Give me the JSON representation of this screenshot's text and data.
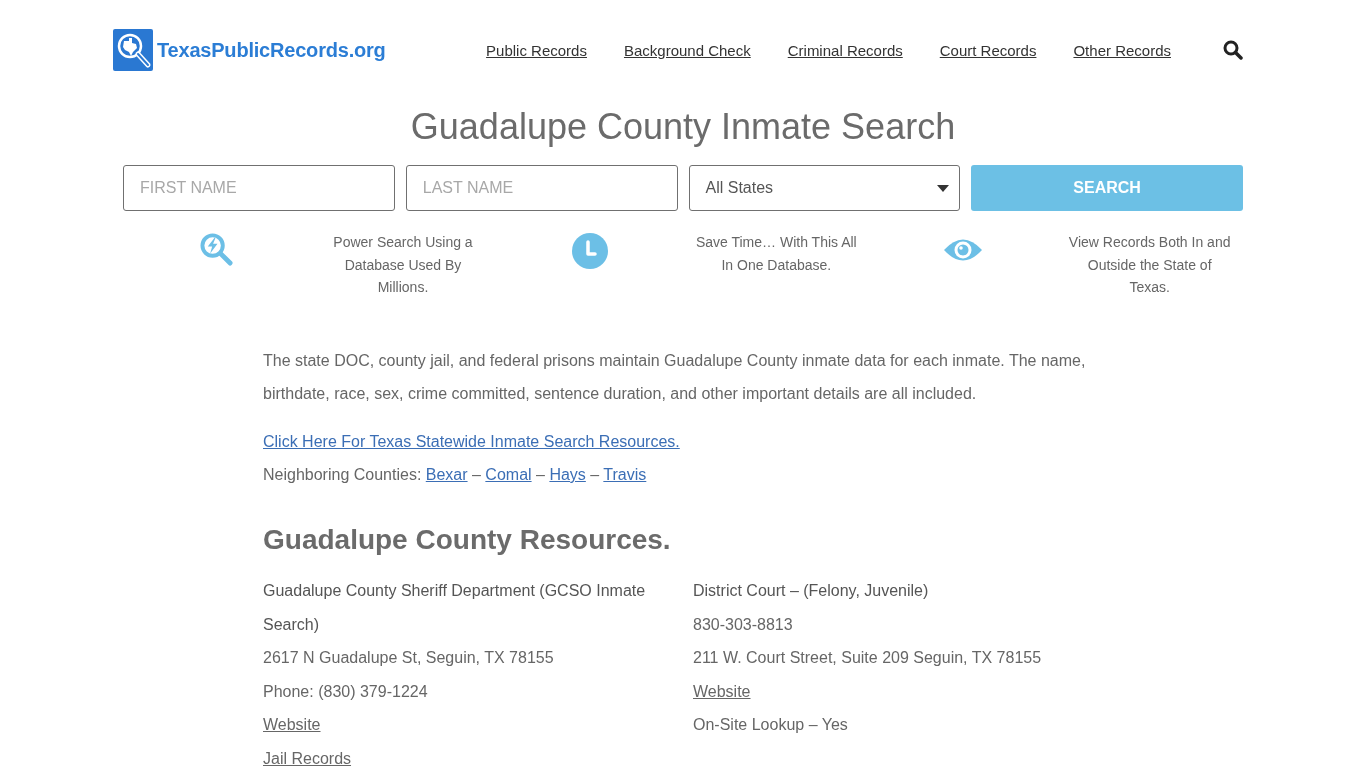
{
  "header": {
    "logo": "TexasPublicRecords.org",
    "nav": [
      "Public Records",
      "Background Check",
      "Criminal Records",
      "Court Records",
      "Other Records"
    ]
  },
  "title": "Guadalupe County Inmate Search",
  "search_form": {
    "first_name": {
      "placeholder": "FIRST NAME"
    },
    "last_name": {
      "placeholder": "LAST NAME"
    },
    "state": {
      "value": "All States"
    },
    "button": "SEARCH"
  },
  "features": [
    {
      "kind": "power-search",
      "text": "Power Search Using a Database Used By Millions."
    },
    {
      "kind": "clock",
      "text": "Save Time… With This All In One Database."
    },
    {
      "kind": "eye",
      "text": "View Records Both In and Outside the State of Texas."
    }
  ],
  "intro": {
    "paragraph": "The state DOC, county jail, and federal prisons maintain Guadalupe County inmate data for each inmate. The name, birthdate, race, sex, crime committed, sentence duration, and other important details are all included.",
    "statewide_link": "Click Here For Texas Statewide Inmate Search Resources.",
    "neighbors": {
      "label": "Neighboring Counties:",
      "counties": [
        "Bexar",
        "Comal",
        "Hays",
        "Travis"
      ],
      "separators": [
        "–",
        "–",
        "–"
      ]
    }
  },
  "resources": {
    "heading": "Guadalupe County Resources.",
    "columns": [
      {
        "items": [
          {
            "kind": "title",
            "text": "Guadalupe County Sheriff Department (GCSO Inmate Search)"
          },
          {
            "kind": "text",
            "text": "2617 N Guadalupe St, Seguin, TX 78155"
          },
          {
            "kind": "text",
            "text": "Phone: (830) 379-1224"
          },
          {
            "kind": "link",
            "text": "Website"
          },
          {
            "kind": "link",
            "text": "Jail Records"
          }
        ]
      },
      {
        "items": [
          {
            "kind": "title",
            "text": "District Court – (Felony, Juvenile)"
          },
          {
            "kind": "text",
            "text": "830-303-8813"
          },
          {
            "kind": "text",
            "text": "211 W. Court Street, Suite 209 Seguin, TX 78155"
          },
          {
            "kind": "link",
            "text": "Website"
          },
          {
            "kind": "text",
            "text": "On-Site Lookup – Yes"
          }
        ]
      }
    ]
  }
}
